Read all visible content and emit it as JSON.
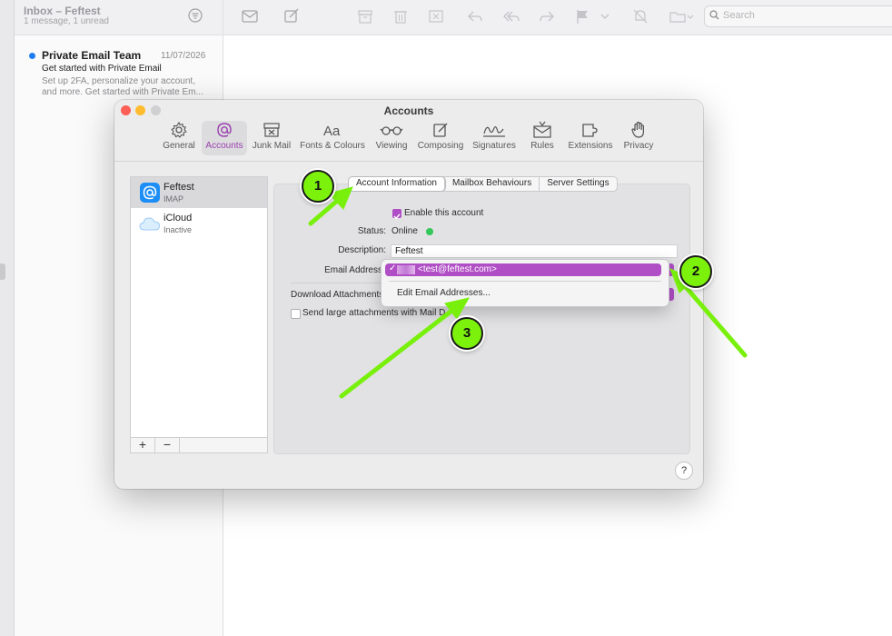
{
  "mail": {
    "mailbox_title": "Inbox – Feftest",
    "mailbox_subtitle": "1 message, 1 unread",
    "search_placeholder": "Search",
    "message": {
      "sender": "Private Email Team",
      "date": "11/07/2026",
      "subject": "Get started with Private Email",
      "preview": "Set up 2FA, personalize your account, and more. Get started with Private Em..."
    }
  },
  "accounts_window": {
    "title": "Accounts",
    "pref_tabs": [
      {
        "label": "General",
        "icon": "gear-icon"
      },
      {
        "label": "Accounts",
        "icon": "at-icon",
        "selected": true
      },
      {
        "label": "Junk Mail",
        "icon": "junk-icon"
      },
      {
        "label": "Fonts & Colours",
        "icon": "font-icon"
      },
      {
        "label": "Viewing",
        "icon": "glasses-icon"
      },
      {
        "label": "Composing",
        "icon": "compose-icon"
      },
      {
        "label": "Signatures",
        "icon": "signature-icon"
      },
      {
        "label": "Rules",
        "icon": "rules-icon"
      },
      {
        "label": "Extensions",
        "icon": "puzzle-icon"
      },
      {
        "label": "Privacy",
        "icon": "hand-icon"
      }
    ],
    "accounts": [
      {
        "name": "Feftest",
        "type": "IMAP",
        "icon": "at-icon"
      },
      {
        "name": "iCloud",
        "type": "Inactive",
        "icon": "cloud-icon"
      }
    ],
    "add_label": "+",
    "remove_label": "−",
    "seg_tabs": [
      "Account Information",
      "Mailbox Behaviours",
      "Server Settings"
    ],
    "form": {
      "enable_label": "Enable this account",
      "status_label": "Status:",
      "status_value": "Online",
      "description_label": "Description:",
      "description_value": "Feftest",
      "email_label": "Email Address",
      "download_label": "Download Attachments",
      "send_large_label": "Send large attachments with Mail D"
    },
    "dropdown": {
      "check": "✓",
      "selected_email": "<test@feftest.com>",
      "edit_label": "Edit Email Addresses..."
    },
    "help_label": "?"
  },
  "callouts": [
    "1",
    "2",
    "3"
  ],
  "colors": {
    "accent": "#b04ec5",
    "callout": "#7cf10c",
    "status_online": "#34c759"
  }
}
